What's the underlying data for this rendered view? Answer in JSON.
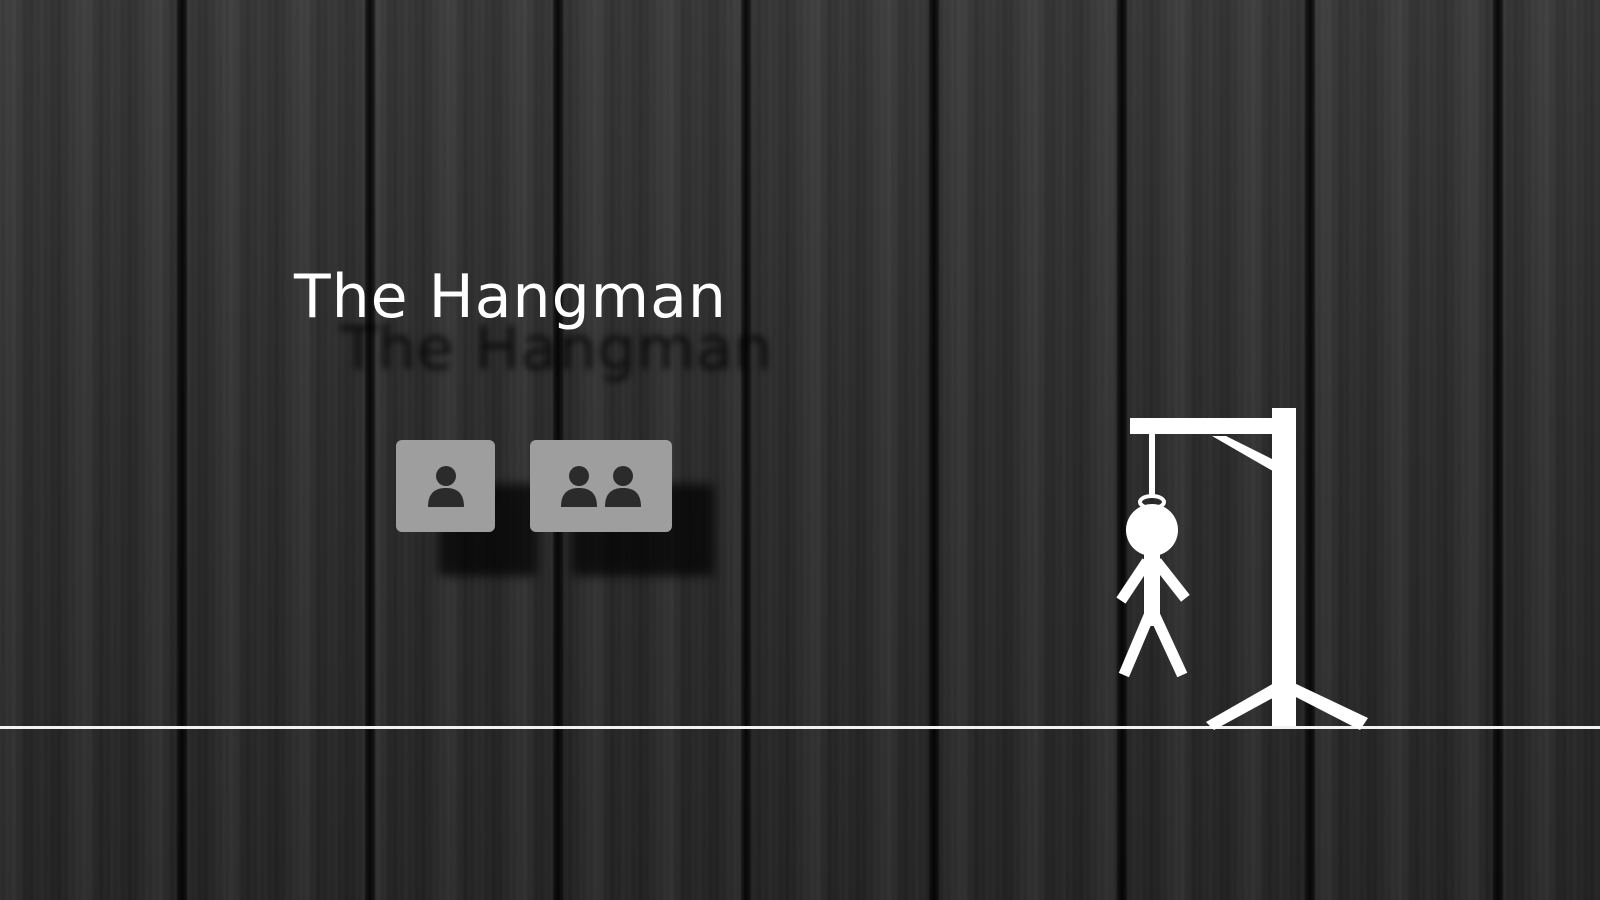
{
  "title": "The Hangman",
  "menu": {
    "single_player_icon": "person-icon",
    "multiplayer_icon": "two-people-icon"
  },
  "colors": {
    "background": "#2a2a2a",
    "title_text": "#ffffff",
    "button_bg": "#9e9e9e",
    "button_icon": "#2b2b2b",
    "drawing": "#ffffff"
  }
}
